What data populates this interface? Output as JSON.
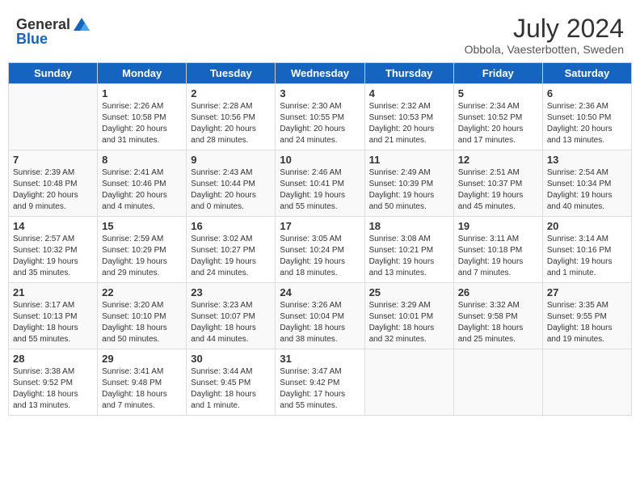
{
  "header": {
    "logo_general": "General",
    "logo_blue": "Blue",
    "month_year": "July 2024",
    "location": "Obbola, Vaesterbotten, Sweden"
  },
  "days_of_week": [
    "Sunday",
    "Monday",
    "Tuesday",
    "Wednesday",
    "Thursday",
    "Friday",
    "Saturday"
  ],
  "weeks": [
    [
      {
        "day": "",
        "info": ""
      },
      {
        "day": "1",
        "info": "Sunrise: 2:26 AM\nSunset: 10:58 PM\nDaylight: 20 hours and 31 minutes."
      },
      {
        "day": "2",
        "info": "Sunrise: 2:28 AM\nSunset: 10:56 PM\nDaylight: 20 hours and 28 minutes."
      },
      {
        "day": "3",
        "info": "Sunrise: 2:30 AM\nSunset: 10:55 PM\nDaylight: 20 hours and 24 minutes."
      },
      {
        "day": "4",
        "info": "Sunrise: 2:32 AM\nSunset: 10:53 PM\nDaylight: 20 hours and 21 minutes."
      },
      {
        "day": "5",
        "info": "Sunrise: 2:34 AM\nSunset: 10:52 PM\nDaylight: 20 hours and 17 minutes."
      },
      {
        "day": "6",
        "info": "Sunrise: 2:36 AM\nSunset: 10:50 PM\nDaylight: 20 hours and 13 minutes."
      }
    ],
    [
      {
        "day": "7",
        "info": "Sunrise: 2:39 AM\nSunset: 10:48 PM\nDaylight: 20 hours and 9 minutes."
      },
      {
        "day": "8",
        "info": "Sunrise: 2:41 AM\nSunset: 10:46 PM\nDaylight: 20 hours and 4 minutes."
      },
      {
        "day": "9",
        "info": "Sunrise: 2:43 AM\nSunset: 10:44 PM\nDaylight: 20 hours and 0 minutes."
      },
      {
        "day": "10",
        "info": "Sunrise: 2:46 AM\nSunset: 10:41 PM\nDaylight: 19 hours and 55 minutes."
      },
      {
        "day": "11",
        "info": "Sunrise: 2:49 AM\nSunset: 10:39 PM\nDaylight: 19 hours and 50 minutes."
      },
      {
        "day": "12",
        "info": "Sunrise: 2:51 AM\nSunset: 10:37 PM\nDaylight: 19 hours and 45 minutes."
      },
      {
        "day": "13",
        "info": "Sunrise: 2:54 AM\nSunset: 10:34 PM\nDaylight: 19 hours and 40 minutes."
      }
    ],
    [
      {
        "day": "14",
        "info": "Sunrise: 2:57 AM\nSunset: 10:32 PM\nDaylight: 19 hours and 35 minutes."
      },
      {
        "day": "15",
        "info": "Sunrise: 2:59 AM\nSunset: 10:29 PM\nDaylight: 19 hours and 29 minutes."
      },
      {
        "day": "16",
        "info": "Sunrise: 3:02 AM\nSunset: 10:27 PM\nDaylight: 19 hours and 24 minutes."
      },
      {
        "day": "17",
        "info": "Sunrise: 3:05 AM\nSunset: 10:24 PM\nDaylight: 19 hours and 18 minutes."
      },
      {
        "day": "18",
        "info": "Sunrise: 3:08 AM\nSunset: 10:21 PM\nDaylight: 19 hours and 13 minutes."
      },
      {
        "day": "19",
        "info": "Sunrise: 3:11 AM\nSunset: 10:18 PM\nDaylight: 19 hours and 7 minutes."
      },
      {
        "day": "20",
        "info": "Sunrise: 3:14 AM\nSunset: 10:16 PM\nDaylight: 19 hours and 1 minute."
      }
    ],
    [
      {
        "day": "21",
        "info": "Sunrise: 3:17 AM\nSunset: 10:13 PM\nDaylight: 18 hours and 55 minutes."
      },
      {
        "day": "22",
        "info": "Sunrise: 3:20 AM\nSunset: 10:10 PM\nDaylight: 18 hours and 50 minutes."
      },
      {
        "day": "23",
        "info": "Sunrise: 3:23 AM\nSunset: 10:07 PM\nDaylight: 18 hours and 44 minutes."
      },
      {
        "day": "24",
        "info": "Sunrise: 3:26 AM\nSunset: 10:04 PM\nDaylight: 18 hours and 38 minutes."
      },
      {
        "day": "25",
        "info": "Sunrise: 3:29 AM\nSunset: 10:01 PM\nDaylight: 18 hours and 32 minutes."
      },
      {
        "day": "26",
        "info": "Sunrise: 3:32 AM\nSunset: 9:58 PM\nDaylight: 18 hours and 25 minutes."
      },
      {
        "day": "27",
        "info": "Sunrise: 3:35 AM\nSunset: 9:55 PM\nDaylight: 18 hours and 19 minutes."
      }
    ],
    [
      {
        "day": "28",
        "info": "Sunrise: 3:38 AM\nSunset: 9:52 PM\nDaylight: 18 hours and 13 minutes."
      },
      {
        "day": "29",
        "info": "Sunrise: 3:41 AM\nSunset: 9:48 PM\nDaylight: 18 hours and 7 minutes."
      },
      {
        "day": "30",
        "info": "Sunrise: 3:44 AM\nSunset: 9:45 PM\nDaylight: 18 hours and 1 minute."
      },
      {
        "day": "31",
        "info": "Sunrise: 3:47 AM\nSunset: 9:42 PM\nDaylight: 17 hours and 55 minutes."
      },
      {
        "day": "",
        "info": ""
      },
      {
        "day": "",
        "info": ""
      },
      {
        "day": "",
        "info": ""
      }
    ]
  ]
}
